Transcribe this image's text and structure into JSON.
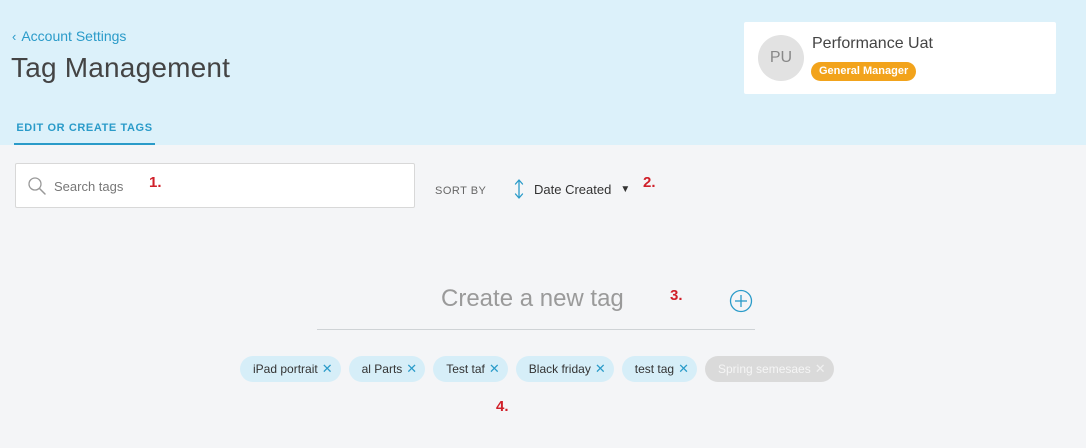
{
  "header": {
    "back_label": "Account Settings",
    "title": "Tag Management"
  },
  "user": {
    "initials": "PU",
    "name": "Performance Uat",
    "role": "General Manager"
  },
  "tabs": [
    {
      "label": "EDIT OR CREATE TAGS",
      "active": true
    }
  ],
  "search": {
    "placeholder": "Search tags",
    "value": ""
  },
  "sort": {
    "label": "SORT BY",
    "value": "Date Created"
  },
  "create": {
    "placeholder": "Create a new tag"
  },
  "tags": [
    {
      "label": "iPad portrait",
      "disabled": false
    },
    {
      "label": "al Parts",
      "disabled": false
    },
    {
      "label": "Test taf",
      "disabled": false
    },
    {
      "label": "Black friday",
      "disabled": false
    },
    {
      "label": "test tag",
      "disabled": false
    },
    {
      "label": "Spring semesaes",
      "disabled": true
    }
  ],
  "annotations": [
    "1.",
    "2.",
    "3.",
    "4."
  ],
  "colors": {
    "header_bg": "#dcf1fa",
    "accent": "#2a9bc9",
    "badge": "#f2a31b",
    "tag_bg": "#d6eef8",
    "annotation": "#d0202a"
  }
}
